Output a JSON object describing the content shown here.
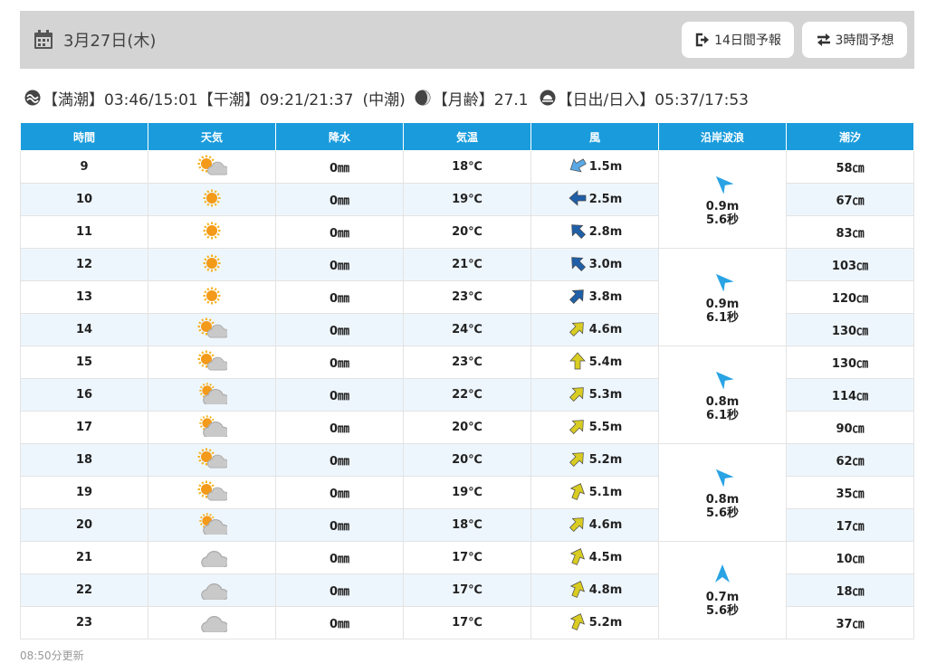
{
  "header": {
    "date": "3月27日(木)",
    "btn_14day": "14日間予報",
    "btn_3hour": "3時間予想",
    "calendar_icon": "calendar-icon",
    "exit_icon": "arrow-right-from-bracket-icon",
    "exchange_icon": "exchange-arrows-icon"
  },
  "tide_info": {
    "high_tide": "【満潮】03:46/15:01",
    "low_tide": "【干潮】09:21/21:37",
    "tide_type": "(中潮)",
    "moon_age": "【月齢】27.1",
    "sun": "【日出/日入】05:37/17:53"
  },
  "table": {
    "headers": [
      "時間",
      "天気",
      "降水",
      "気温",
      "風",
      "沿岸波浪",
      "潮汐"
    ],
    "rows": [
      {
        "time": "9",
        "weather": "sun-cloud",
        "rain": "0㎜",
        "temp": "18℃",
        "wind_dir": 240,
        "wind_color": "#5aa9e6",
        "wind": "1.5m",
        "tide": "58㎝"
      },
      {
        "time": "10",
        "weather": "sun",
        "rain": "0㎜",
        "temp": "19℃",
        "wind_dir": 270,
        "wind_color": "#1f5fa8",
        "wind": "2.5m",
        "tide": "67㎝"
      },
      {
        "time": "11",
        "weather": "sun",
        "rain": "0㎜",
        "temp": "20℃",
        "wind_dir": 315,
        "wind_color": "#1f5fa8",
        "wind": "2.8m",
        "tide": "83㎝"
      },
      {
        "time": "12",
        "weather": "sun",
        "rain": "0㎜",
        "temp": "21℃",
        "wind_dir": 315,
        "wind_color": "#1f5fa8",
        "wind": "3.0m",
        "tide": "103㎝"
      },
      {
        "time": "13",
        "weather": "sun",
        "rain": "0㎜",
        "temp": "23℃",
        "wind_dir": 45,
        "wind_color": "#1f5fa8",
        "wind": "3.8m",
        "tide": "120㎝"
      },
      {
        "time": "14",
        "weather": "sun-cloud",
        "rain": "0㎜",
        "temp": "24℃",
        "wind_dir": 45,
        "wind_color": "#d9cc22",
        "wind": "4.6m",
        "tide": "130㎝"
      },
      {
        "time": "15",
        "weather": "sun-cloud",
        "rain": "0㎜",
        "temp": "23℃",
        "wind_dir": 0,
        "wind_color": "#d9cc22",
        "wind": "5.4m",
        "tide": "130㎝"
      },
      {
        "time": "16",
        "weather": "cloud-sun",
        "rain": "0㎜",
        "temp": "22℃",
        "wind_dir": 45,
        "wind_color": "#d9cc22",
        "wind": "5.3m",
        "tide": "114㎝"
      },
      {
        "time": "17",
        "weather": "cloud-sun",
        "rain": "0㎜",
        "temp": "20℃",
        "wind_dir": 45,
        "wind_color": "#d9cc22",
        "wind": "5.5m",
        "tide": "90㎝"
      },
      {
        "time": "18",
        "weather": "sun-cloud",
        "rain": "0㎜",
        "temp": "20℃",
        "wind_dir": 45,
        "wind_color": "#d9cc22",
        "wind": "5.2m",
        "tide": "62㎝"
      },
      {
        "time": "19",
        "weather": "sun-cloud",
        "rain": "0㎜",
        "temp": "19℃",
        "wind_dir": 22,
        "wind_color": "#d9cc22",
        "wind": "5.1m",
        "tide": "35㎝"
      },
      {
        "time": "20",
        "weather": "cloud-sun",
        "rain": "0㎜",
        "temp": "18℃",
        "wind_dir": 45,
        "wind_color": "#d9cc22",
        "wind": "4.6m",
        "tide": "17㎝"
      },
      {
        "time": "21",
        "weather": "cloud",
        "rain": "0㎜",
        "temp": "17℃",
        "wind_dir": 22,
        "wind_color": "#d9cc22",
        "wind": "4.5m",
        "tide": "10㎝"
      },
      {
        "time": "22",
        "weather": "cloud",
        "rain": "0㎜",
        "temp": "17℃",
        "wind_dir": 22,
        "wind_color": "#d9cc22",
        "wind": "4.8m",
        "tide": "18㎝"
      },
      {
        "time": "23",
        "weather": "cloud",
        "rain": "0㎜",
        "temp": "17℃",
        "wind_dir": 22,
        "wind_color": "#d9cc22",
        "wind": "5.2m",
        "tide": "37㎝"
      }
    ],
    "waves": [
      {
        "height": "0.9m",
        "period": "5.6秒",
        "dir": 315
      },
      {
        "height": "0.9m",
        "period": "6.1秒",
        "dir": 315
      },
      {
        "height": "0.8m",
        "period": "6.1秒",
        "dir": 315
      },
      {
        "height": "0.8m",
        "period": "5.6秒",
        "dir": 315
      },
      {
        "height": "0.7m",
        "period": "5.6秒",
        "dir": 0
      }
    ]
  },
  "footer": "08:50分更新",
  "colors": {
    "header_bg": "#d4d4d4",
    "table_header": "#1a9cdc",
    "row_alt": "#eef6fd",
    "wave_arrow": "#29a3e4"
  }
}
